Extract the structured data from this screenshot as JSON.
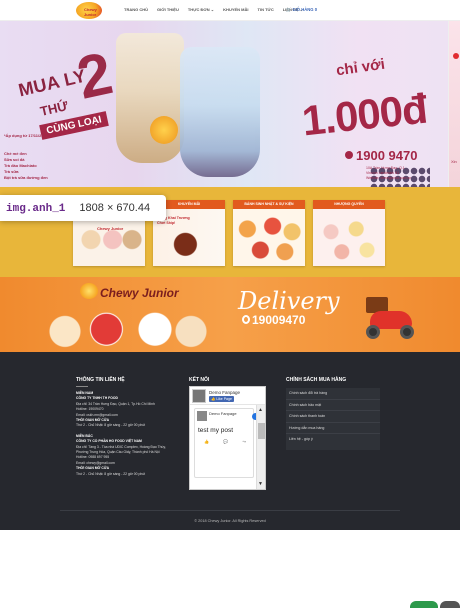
{
  "header": {
    "logo_text": "Chewy Junior",
    "nav": [
      "TRANG CHỦ",
      "GIỚI THIỆU",
      "THỰC ĐƠN ⌄",
      "KHUYẾN MÃI",
      "TIN TỨC",
      "LIÊN HỆ ⌄"
    ],
    "cart_label": "GIỎ HÀNG",
    "cart_count": "0"
  },
  "hero": {
    "line1": "MUA LY",
    "line2": "THỨ",
    "big_number": "2",
    "tag": "CÙNG LOẠI",
    "chi_voi": "chỉ với",
    "price": "1.000đ",
    "hotline": "1900 9470",
    "note": "*Áp dụng từ 17/11/2017",
    "list": [
      "Chè mè đen",
      "Sữa soi đá",
      "Trà đào Machiato",
      "Trà sữa",
      "Bột trà sữa đường đen"
    ],
    "addresses": [
      "10A Trần Hưng Đạo, Q.1",
      "Vincom Landmark 81",
      "Website: chewyjunior.com.vn"
    ],
    "peek_text": "Xin"
  },
  "tooltip": {
    "tag": "img.anh_1",
    "dims": "1808 × 670.44"
  },
  "promo_cards": [
    {
      "label": "",
      "text": "Chewy Junior"
    },
    {
      "label": "KHUYẾN MÃI",
      "text": "Mừng Khai Trương Chơi Ship!"
    },
    {
      "label": "BÁNH SINH NHẬT & SỰ KIỆN",
      "text": ""
    },
    {
      "label": "NHƯỢNG QUYỀN",
      "text": ""
    }
  ],
  "delivery": {
    "brand": "Chewy Junior",
    "title": "Delivery",
    "phone": "19009470"
  },
  "footer": {
    "contact_heading": "THÔNG TIN LIÊN HỆ",
    "contact_south": [
      {
        "t": "MIỀN NAM",
        "b": true
      },
      {
        "t": "CÔNG TY TNHH TH FOOD",
        "b": true
      },
      {
        "t": "Địa chỉ: 34 Trần Hưng Đạo, Quận 1, Tp.Hồ Chí Minh",
        "b": false
      },
      {
        "t": "Hotline: 19009470",
        "b": false
      },
      {
        "t": "Email: cskh.mn@gmail.com",
        "b": false
      },
      {
        "t": "THỜI GIAN MỞ CỬA",
        "b": true
      },
      {
        "t": "Thứ 2 - Chủ Nhật: 8 giờ sáng - 22 giờ 00 phút",
        "b": false
      }
    ],
    "contact_north": [
      {
        "t": "MIỀN BẮC",
        "b": true
      },
      {
        "t": "CÔNG TY CỔ PHẦN HG FOOD VIỆT NAM",
        "b": true
      },
      {
        "t": "Địa chỉ: Tầng 3 - Tòa nhà UDIC Complex, Hoàng Đạo Thúy,",
        "b": false
      },
      {
        "t": "Phường Trung Hòa, Quận Cầu Giấy, Thành phố Hà Nội",
        "b": false
      },
      {
        "t": "Hotline: 0988 697 955",
        "b": false
      },
      {
        "t": "Email: chewy@gmail.com",
        "b": false
      },
      {
        "t": "THỜI GIAN MỞ CỬA",
        "b": true
      },
      {
        "t": "Thứ 2 - Chủ Nhật: 8 giờ sáng - 22 giờ 00 phút",
        "b": false
      }
    ],
    "connect_heading": "KẾT NỐI",
    "fb_page_name": "Demo Fanpage",
    "fb_like": "👍 Like Page",
    "fb_post_name": "Demo Fanpage",
    "fb_post_text": "test my post",
    "fb_actions": [
      "👍",
      "💬",
      "↪"
    ],
    "policy_heading": "CHÍNH SÁCH MUA HÀNG",
    "policy_items": [
      "Chính sách đổi trả hàng",
      "Chính sách bảo mật",
      "Chính sách thanh toán",
      "Hướng dẫn mua hàng",
      "Liên hệ - góp ý"
    ],
    "copyright": "© 2018 Chewy Junior. All Rights Reserved"
  },
  "colors": {
    "brand_red": "#a42747",
    "yellow": "#e8b63a",
    "orange": "#f08a2e",
    "footer_bg": "#26282e"
  }
}
